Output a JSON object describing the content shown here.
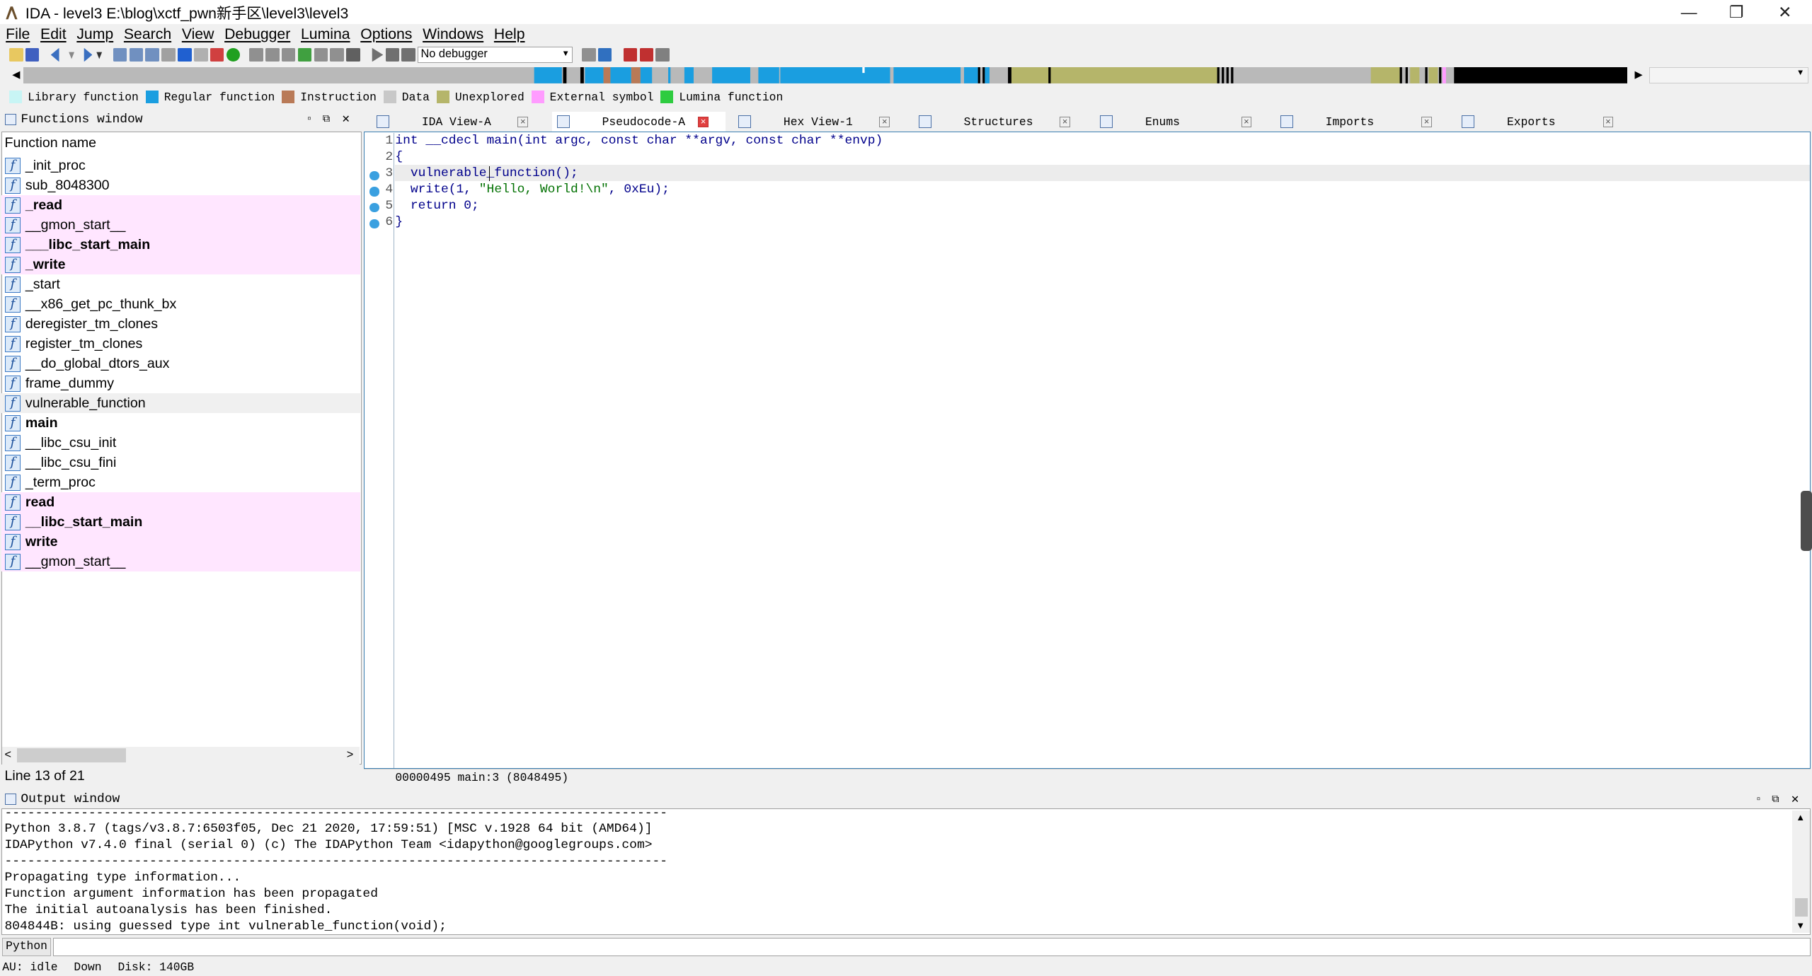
{
  "window": {
    "title": "IDA - level3 E:\\blog\\xctf_pwn新手区\\level3\\level3",
    "minimize": "—",
    "restore": "❐",
    "close": "✕"
  },
  "menu": [
    "File",
    "Edit",
    "Jump",
    "Search",
    "View",
    "Debugger",
    "Lumina",
    "Options",
    "Windows",
    "Help"
  ],
  "toolbar": {
    "debugger_select": "No debugger"
  },
  "legend": [
    {
      "label": "Library function",
      "color": "#c8f5f5"
    },
    {
      "label": "Regular function",
      "color": "#1a9ee0"
    },
    {
      "label": "Instruction",
      "color": "#b97a57"
    },
    {
      "label": "Data",
      "color": "#c8c8c8"
    },
    {
      "label": "Unexplored",
      "color": "#b5b56a"
    },
    {
      "label": "External symbol",
      "color": "#ff9cff"
    },
    {
      "label": "Lumina function",
      "color": "#2ecc40"
    }
  ],
  "functions_window": {
    "title": "Functions window",
    "column_header": "Function name",
    "status": "Line 13 of 21",
    "items": [
      {
        "name": "_init_proc",
        "bold": false,
        "ext": false
      },
      {
        "name": "sub_8048300",
        "bold": false,
        "ext": false
      },
      {
        "name": "_read",
        "bold": true,
        "ext": true
      },
      {
        "name": "__gmon_start__",
        "bold": false,
        "ext": true
      },
      {
        "name": "___libc_start_main",
        "bold": true,
        "ext": true
      },
      {
        "name": "_write",
        "bold": true,
        "ext": true
      },
      {
        "name": "_start",
        "bold": false,
        "ext": false
      },
      {
        "name": "__x86_get_pc_thunk_bx",
        "bold": false,
        "ext": false
      },
      {
        "name": "deregister_tm_clones",
        "bold": false,
        "ext": false
      },
      {
        "name": "register_tm_clones",
        "bold": false,
        "ext": false
      },
      {
        "name": "__do_global_dtors_aux",
        "bold": false,
        "ext": false
      },
      {
        "name": "frame_dummy",
        "bold": false,
        "ext": false
      },
      {
        "name": "vulnerable_function",
        "bold": false,
        "ext": false,
        "selected": true
      },
      {
        "name": "main",
        "bold": true,
        "ext": false
      },
      {
        "name": "__libc_csu_init",
        "bold": false,
        "ext": false
      },
      {
        "name": "__libc_csu_fini",
        "bold": false,
        "ext": false
      },
      {
        "name": "_term_proc",
        "bold": false,
        "ext": false
      },
      {
        "name": "read",
        "bold": true,
        "ext": true
      },
      {
        "name": "__libc_start_main",
        "bold": true,
        "ext": true
      },
      {
        "name": "write",
        "bold": true,
        "ext": true
      },
      {
        "name": "__gmon_start__",
        "bold": false,
        "ext": true
      }
    ]
  },
  "tabs": [
    {
      "label": "IDA View-A",
      "active": false
    },
    {
      "label": "Pseudocode-A",
      "active": true
    },
    {
      "label": "Hex View-1",
      "active": false
    },
    {
      "label": "Structures",
      "active": false
    },
    {
      "label": "Enums",
      "active": false
    },
    {
      "label": "Imports",
      "active": false
    },
    {
      "label": "Exports",
      "active": false
    }
  ],
  "pseudocode": {
    "lines": [
      {
        "num": "1",
        "text": "int __cdecl main(int argc, const char **argv, const char **envp)",
        "dot": false
      },
      {
        "num": "2",
        "text": "{",
        "dot": false
      },
      {
        "num": "3",
        "text": "  vulnerable_function();",
        "dot": true
      },
      {
        "num": "4",
        "pre": "  write(1, ",
        "str": "\"Hello, World!\\n\"",
        "post": ", 0xEu);",
        "dot": true
      },
      {
        "num": "5",
        "text": "  return 0;",
        "dot": true
      },
      {
        "num": "6",
        "text": "}",
        "dot": true
      }
    ],
    "status": "00000495 main:3 (8048495)"
  },
  "output_window": {
    "title": "Output window",
    "lines": [
      "---------------------------------------------------------------------------------------",
      "Python 3.8.7 (tags/v3.8.7:6503f05, Dec 21 2020, 17:59:51) [MSC v.1928 64 bit (AMD64)]",
      "IDAPython v7.4.0 final (serial 0) (c) The IDAPython Team <idapython@googlegroups.com>",
      "---------------------------------------------------------------------------------------",
      "Propagating type information...",
      "Function argument information has been propagated",
      "The initial autoanalysis has been finished.",
      "804844B: using guessed type int vulnerable_function(void);"
    ]
  },
  "python_button": "Python",
  "statusbar": {
    "au": "AU:",
    "state": "idle",
    "dir": "Down",
    "disk": "Disk: 140GB"
  }
}
